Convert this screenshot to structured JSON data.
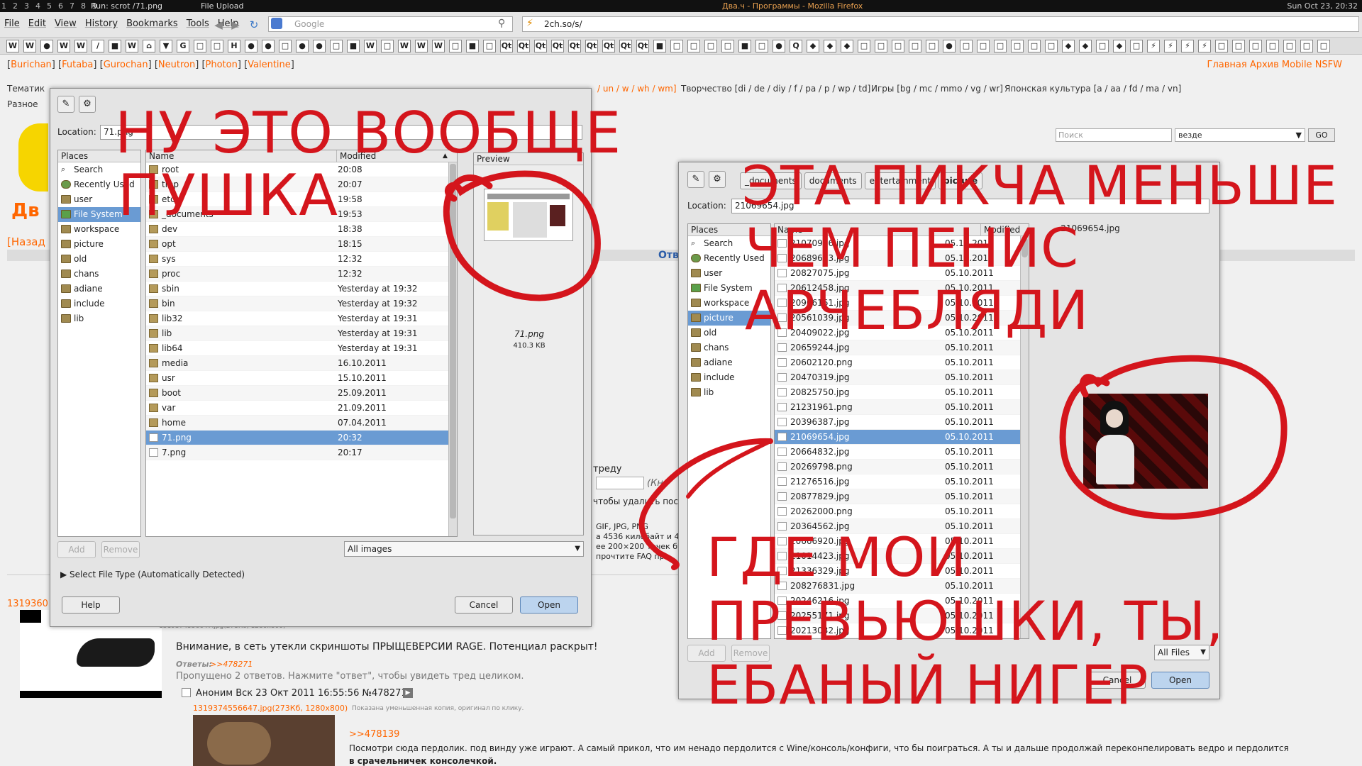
{
  "topbar": {
    "workspaces": [
      "1",
      "2",
      "3",
      "4",
      "5",
      "6",
      "7",
      "8",
      "9"
    ],
    "run_title": "Run: scrot /71.png",
    "upload_title": "File Upload",
    "firefox_title": "Два.ч - Программы - Mozilla Firefox",
    "clock": "Sun Oct 23, 20:32"
  },
  "menubar": {
    "items": [
      "File",
      "Edit",
      "View",
      "History",
      "Bookmarks",
      "Tools",
      "Help"
    ],
    "search_placeholder": "Google",
    "url": "2ch.so/s/"
  },
  "bookmarks": [
    "W",
    "W",
    "●",
    "W",
    "W",
    "/",
    "■",
    "W",
    "⌂",
    "▼",
    "G",
    "□",
    "□",
    "H",
    "●",
    "●",
    "□",
    "●",
    "●",
    "□",
    "■",
    "W",
    "□",
    "W",
    "W",
    "W",
    "□",
    "■",
    "□",
    "Qt",
    "Qt",
    "Qt",
    "Qt",
    "Qt",
    "Qt",
    "Qt",
    "Qt",
    "Qt",
    "■",
    "□",
    "□",
    "□",
    "□",
    "■",
    "□",
    "●",
    "Q",
    "◆",
    "◆",
    "◆",
    "□",
    "□",
    "□",
    "□",
    "□",
    "●",
    "□",
    "□",
    "□",
    "□",
    "□",
    "□",
    "◆",
    "◆",
    "□",
    "◆",
    "□",
    "⚡",
    "⚡",
    "⚡",
    "⚡",
    "□",
    "□",
    "□",
    "□",
    "□",
    "□",
    "□"
  ],
  "site": {
    "boards": [
      "Burichan",
      "Futaba",
      "Gurochan",
      "Neutron",
      "Photon",
      "Valentine"
    ],
    "toplinks": "Главная Архив Mobile NSFW",
    "cat_prefix": "/ un / w / wh / wm]",
    "cat_creativity": "Творчество [di / de / diy / f / pa / p / wp / td]",
    "cat_games": "Игры [bg / mc / mmo / vg / wr]",
    "cat_japan": "Японская культура [a / aa / fd / ma / vn]",
    "label_thematic": "Тематик",
    "label_misc": "Разное",
    "search_placeholder": "Поиск",
    "search_scope": "везде",
    "search_button": "GO",
    "back_link": "[Назад",
    "ote": "Отв",
    "post_number_left": "1319360",
    "thumb_caption": "1319374556647.jpg(273Кб, 1280x800)",
    "post_text_1": "Внимание, в сеть утекли скриншоты ПРЫЩЕВЕРСИИ RAGE. Потенциал раскрыт!",
    "replies_label": "Ответы:",
    "replies_link": ">>478271",
    "skipped": "Пропущено 2 ответов. Нажмите \"ответ\", чтобы увидеть тред целиком.",
    "post2_header": "Аноним  Вск 23 Окт 2011 16:55:56 №478271",
    "post2_file": "1319374556647.jpg(273Кб, 1280x800)",
    "post2_thumbnote": "Показана уменьшенная копия, оригинал по клику.",
    "post2_reply": ">>478139",
    "post2_text": "Посмотри сюда пердолик. под винду уже играют. А самый прикол, что им ненадо пердолится с Wine/консоль/конфиги, что бы поиграться. А ты и дальше продолжай переконпелировать ведро и пердолится",
    "post2_text2": "в срачельничек консолечкой.",
    "form_frag_1": "треду",
    "form_frag_2": "(Кн",
    "form_frag_3": "чтобы удалить пост",
    "form_frag_4": "GIF, JPG, PNG",
    "form_frag_5": "а 4536 килобайт и 4",
    "form_frag_6": "ее 200×200 точек бу",
    "form_frag_7": "прочтите FAQ пра"
  },
  "dialog_left": {
    "location_label": "Location:",
    "location_value": "71.png",
    "places_header": "Places",
    "places": [
      "Search",
      "Recently Used",
      "user",
      "File System",
      "workspace",
      "picture",
      "old",
      "chans",
      "adiane",
      "include",
      "lib"
    ],
    "col_name": "Name",
    "col_modified": "Modified",
    "files": [
      {
        "name": "root",
        "mod": "20:08"
      },
      {
        "name": "tmp",
        "mod": "20:07"
      },
      {
        "name": "etc",
        "mod": "19:58"
      },
      {
        "name": "_documents",
        "mod": "19:53"
      },
      {
        "name": "dev",
        "mod": "18:38"
      },
      {
        "name": "opt",
        "mod": "18:15"
      },
      {
        "name": "sys",
        "mod": "12:32"
      },
      {
        "name": "proc",
        "mod": "12:32"
      },
      {
        "name": "sbin",
        "mod": "Yesterday at 19:32"
      },
      {
        "name": "bin",
        "mod": "Yesterday at 19:32"
      },
      {
        "name": "lib32",
        "mod": "Yesterday at 19:31"
      },
      {
        "name": "lib",
        "mod": "Yesterday at 19:31"
      },
      {
        "name": "lib64",
        "mod": "Yesterday at 19:31"
      },
      {
        "name": "media",
        "mod": "16.10.2011"
      },
      {
        "name": "usr",
        "mod": "15.10.2011"
      },
      {
        "name": "boot",
        "mod": "25.09.2011"
      },
      {
        "name": "var",
        "mod": "21.09.2011"
      },
      {
        "name": "home",
        "mod": "07.04.2011"
      },
      {
        "name": "71.png",
        "mod": "20:32"
      },
      {
        "name": "7.png",
        "mod": "20:17"
      }
    ],
    "preview_header": "Preview",
    "preview_name": "71.png",
    "preview_size": "410.3 KB",
    "add": "Add",
    "remove": "Remove",
    "filter": "All images",
    "select_type": "Select File Type (Automatically Detected)",
    "help": "Help",
    "cancel": "Cancel",
    "open": "Open"
  },
  "dialog_right": {
    "crumbs": [
      "_documents",
      "documents",
      "entertainment",
      "picture"
    ],
    "location_label": "Location:",
    "location_value": "21069654.jpg",
    "places_header": "Places",
    "places": [
      "Search",
      "Recently Used",
      "user",
      "File System",
      "workspace",
      "picture",
      "old",
      "chans",
      "adiane",
      "include",
      "lib"
    ],
    "col_name": "Name",
    "col_modified": "Modified",
    "files": [
      {
        "name": "21070956.jpg",
        "mod": "05.10.2011"
      },
      {
        "name": "20689693.jpg",
        "mod": "05.10.2011"
      },
      {
        "name": "20827075.jpg",
        "mod": "05.10.2011"
      },
      {
        "name": "20612458.jpg",
        "mod": "05.10.2011"
      },
      {
        "name": "20906161.jpg",
        "mod": "05.10.2011"
      },
      {
        "name": "20561039.jpg",
        "mod": "05.10.2011"
      },
      {
        "name": "20409022.jpg",
        "mod": "05.10.2011"
      },
      {
        "name": "20659244.jpg",
        "mod": "05.10.2011"
      },
      {
        "name": "20602120.png",
        "mod": "05.10.2011"
      },
      {
        "name": "20470319.jpg",
        "mod": "05.10.2011"
      },
      {
        "name": "20825750.jpg",
        "mod": "05.10.2011"
      },
      {
        "name": "21231961.png",
        "mod": "05.10.2011"
      },
      {
        "name": "20396387.jpg",
        "mod": "05.10.2011"
      },
      {
        "name": "21069654.jpg",
        "mod": "05.10.2011"
      },
      {
        "name": "20664832.jpg",
        "mod": "05.10.2011"
      },
      {
        "name": "20269798.png",
        "mod": "05.10.2011"
      },
      {
        "name": "21276516.jpg",
        "mod": "05.10.2011"
      },
      {
        "name": "20877829.jpg",
        "mod": "05.10.2011"
      },
      {
        "name": "20262000.png",
        "mod": "05.10.2011"
      },
      {
        "name": "20364562.jpg",
        "mod": "05.10.2011"
      },
      {
        "name": "20666920.jpg",
        "mod": "05.10.2011"
      },
      {
        "name": "21014423.jpg",
        "mod": "05.10.2011"
      },
      {
        "name": "21336329.jpg",
        "mod": "05.10.2011"
      },
      {
        "name": "208276831.jpg",
        "mod": "05.10.2011"
      },
      {
        "name": "20246216.jpg",
        "mod": "05.10.2011"
      },
      {
        "name": "20255171.jpg",
        "mod": "05.10.2011"
      },
      {
        "name": "20213032.jpg",
        "mod": "05.10.2011"
      }
    ],
    "preview_name": "21069654.jpg",
    "add": "Add",
    "remove": "Remove",
    "filter": "All Files",
    "cancel": "Cancel",
    "open": "Open"
  },
  "annotations": {
    "left_1": "НУ ЭТО ВООБЩЕ",
    "left_2": "ПУШКА",
    "right_1": "ЭТА ПИКЧА МЕНЬШЕ",
    "right_2": "ЧЕМ ПЕНИС",
    "right_3": "АРЧЕБЛЯДИ",
    "bottom_1": "ГДЕ МОИ",
    "bottom_2": "ПРЕВЬЮШКИ, ТЫ,",
    "bottom_3": "ЕБАНЫЙ НИГЕР",
    "color": "#d4151c"
  }
}
